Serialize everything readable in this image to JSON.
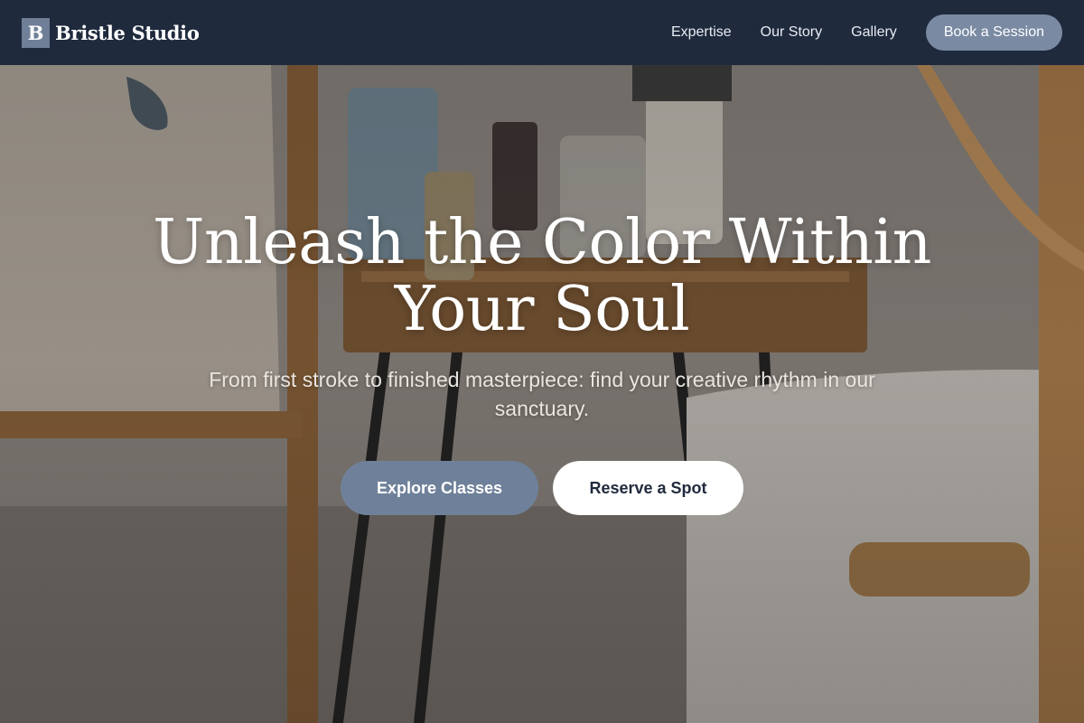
{
  "brand": {
    "mark": "B",
    "name": "Bristle Studio"
  },
  "nav": {
    "links": [
      "Expertise",
      "Our Story",
      "Gallery"
    ],
    "cta": "Book a Session"
  },
  "hero": {
    "headline": "Unleash the Color Within Your Soul",
    "subheadline": "From first stroke to finished masterpiece: find your creative rhythm in our sanctuary.",
    "primary_button": "Explore Classes",
    "secondary_button": "Reserve a Spot"
  },
  "colors": {
    "nav_background": "#1f2a3d",
    "accent": "#6f819a",
    "white": "#ffffff"
  }
}
